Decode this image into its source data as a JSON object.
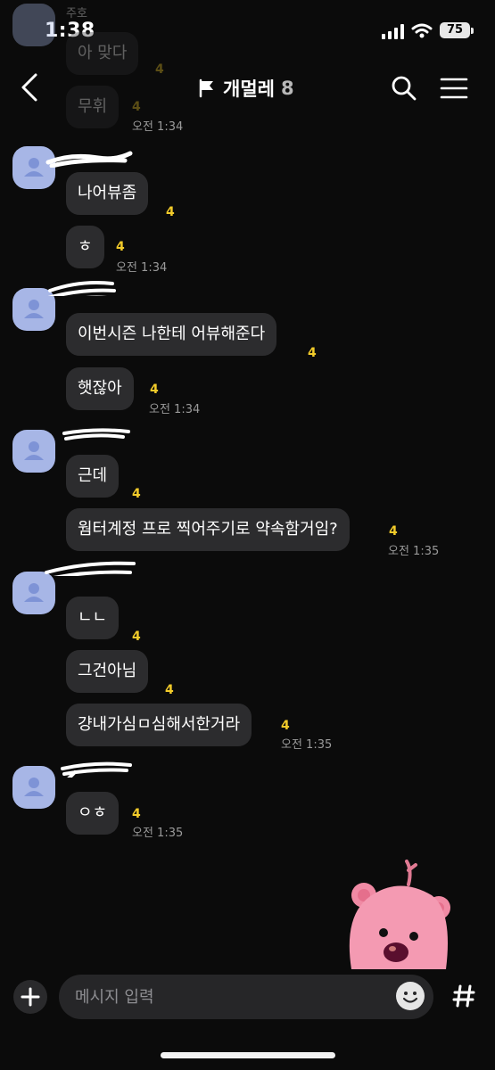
{
  "status_bar": {
    "time": "1:38",
    "battery": "75"
  },
  "header": {
    "title": "개멀레",
    "member_count": "8"
  },
  "faded_messages": [
    {
      "text": "아 맞다",
      "unread": "4"
    },
    {
      "text": "무휘",
      "unread": "4",
      "time": "오전 1:34"
    },
    {
      "name": "주호"
    }
  ],
  "messages": [
    {
      "text": "나어뷰좀",
      "unread": "4"
    },
    {
      "text": "ㅎ",
      "unread": "4",
      "time": "오전 1:34"
    },
    {
      "text": "이번시즌 나한테 어뷰해준다",
      "unread": "4"
    },
    {
      "text": "햇잖아",
      "unread": "4",
      "time": "오전 1:34"
    },
    {
      "text": "근데",
      "unread": "4"
    },
    {
      "text": "웜터계정 프로 찍어주기로 약속함거임?",
      "unread": "4",
      "time": "오전 1:35"
    },
    {
      "text": "ㄴㄴ",
      "unread": "4"
    },
    {
      "text": "그건아님",
      "unread": "4"
    },
    {
      "text": "걍내가심ㅁ심해서한거라",
      "unread": "4",
      "time": "오전 1:35"
    },
    {
      "text": "ㅇㅎ",
      "unread": "4",
      "time": "오전 1:35"
    }
  ],
  "input": {
    "placeholder": "메시지 입력"
  },
  "icons": {
    "back": "chevron-left-icon",
    "flag": "flag-icon",
    "search": "search-icon",
    "menu": "hamburger-menu-icon",
    "plus": "plus-icon",
    "emoji": "emoji-icon",
    "hash": "hash-icon"
  },
  "colors": {
    "background": "#0b0b0b",
    "bubble": "#2c2c2e",
    "unread": "#f2cb2a",
    "avatar": "#a7b6e6"
  }
}
